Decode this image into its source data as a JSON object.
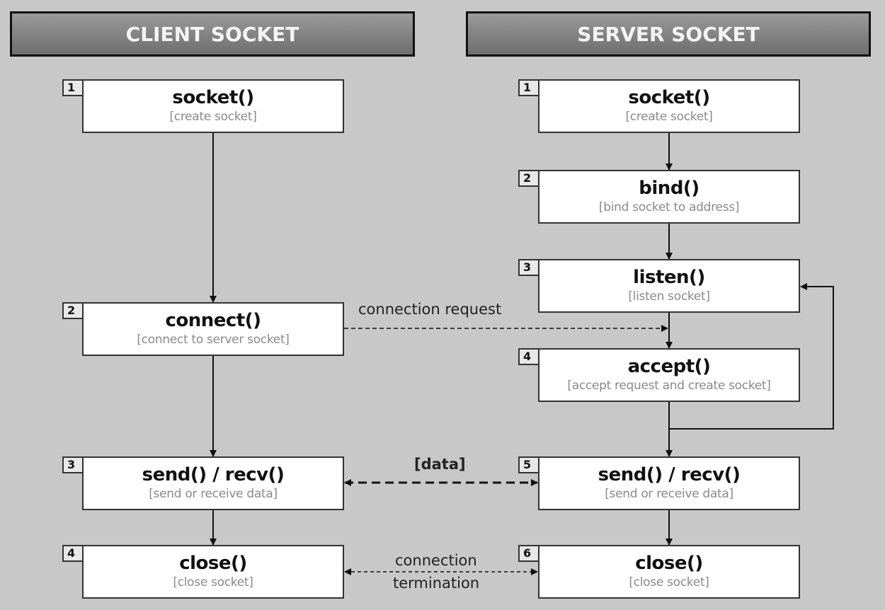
{
  "client": {
    "header": "CLIENT SOCKET",
    "steps": [
      {
        "num": "1",
        "title": "socket()",
        "desc": "[create socket]"
      },
      {
        "num": "2",
        "title": "connect()",
        "desc": "[connect to server socket]"
      },
      {
        "num": "3",
        "title": "send() / recv()",
        "desc": "[send or receive data]"
      },
      {
        "num": "4",
        "title": "close()",
        "desc": "[close socket]"
      }
    ]
  },
  "server": {
    "header": "SERVER SOCKET",
    "steps": [
      {
        "num": "1",
        "title": "socket()",
        "desc": "[create socket]"
      },
      {
        "num": "2",
        "title": "bind()",
        "desc": "[bind socket to address]"
      },
      {
        "num": "3",
        "title": "listen()",
        "desc": "[listen socket]"
      },
      {
        "num": "4",
        "title": "accept()",
        "desc": "[accept request and create socket]"
      },
      {
        "num": "5",
        "title": "send() / recv()",
        "desc": "[send or receive data]"
      },
      {
        "num": "6",
        "title": "close()",
        "desc": "[close socket]"
      }
    ]
  },
  "links": {
    "connection_request": "connection request",
    "data": "[data]",
    "termination_line1": "connection",
    "termination_line2": "termination"
  }
}
